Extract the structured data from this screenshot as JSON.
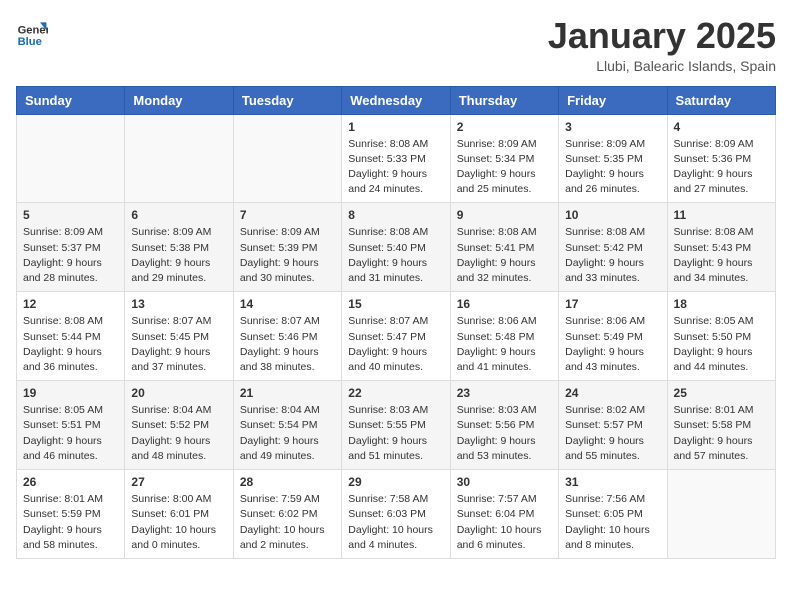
{
  "header": {
    "logo_general": "General",
    "logo_blue": "Blue",
    "month_title": "January 2025",
    "location": "Llubi, Balearic Islands, Spain"
  },
  "weekdays": [
    "Sunday",
    "Monday",
    "Tuesday",
    "Wednesday",
    "Thursday",
    "Friday",
    "Saturday"
  ],
  "weeks": [
    [
      {
        "day": "",
        "info": ""
      },
      {
        "day": "",
        "info": ""
      },
      {
        "day": "",
        "info": ""
      },
      {
        "day": "1",
        "info": "Sunrise: 8:08 AM\nSunset: 5:33 PM\nDaylight: 9 hours\nand 24 minutes."
      },
      {
        "day": "2",
        "info": "Sunrise: 8:09 AM\nSunset: 5:34 PM\nDaylight: 9 hours\nand 25 minutes."
      },
      {
        "day": "3",
        "info": "Sunrise: 8:09 AM\nSunset: 5:35 PM\nDaylight: 9 hours\nand 26 minutes."
      },
      {
        "day": "4",
        "info": "Sunrise: 8:09 AM\nSunset: 5:36 PM\nDaylight: 9 hours\nand 27 minutes."
      }
    ],
    [
      {
        "day": "5",
        "info": "Sunrise: 8:09 AM\nSunset: 5:37 PM\nDaylight: 9 hours\nand 28 minutes."
      },
      {
        "day": "6",
        "info": "Sunrise: 8:09 AM\nSunset: 5:38 PM\nDaylight: 9 hours\nand 29 minutes."
      },
      {
        "day": "7",
        "info": "Sunrise: 8:09 AM\nSunset: 5:39 PM\nDaylight: 9 hours\nand 30 minutes."
      },
      {
        "day": "8",
        "info": "Sunrise: 8:08 AM\nSunset: 5:40 PM\nDaylight: 9 hours\nand 31 minutes."
      },
      {
        "day": "9",
        "info": "Sunrise: 8:08 AM\nSunset: 5:41 PM\nDaylight: 9 hours\nand 32 minutes."
      },
      {
        "day": "10",
        "info": "Sunrise: 8:08 AM\nSunset: 5:42 PM\nDaylight: 9 hours\nand 33 minutes."
      },
      {
        "day": "11",
        "info": "Sunrise: 8:08 AM\nSunset: 5:43 PM\nDaylight: 9 hours\nand 34 minutes."
      }
    ],
    [
      {
        "day": "12",
        "info": "Sunrise: 8:08 AM\nSunset: 5:44 PM\nDaylight: 9 hours\nand 36 minutes."
      },
      {
        "day": "13",
        "info": "Sunrise: 8:07 AM\nSunset: 5:45 PM\nDaylight: 9 hours\nand 37 minutes."
      },
      {
        "day": "14",
        "info": "Sunrise: 8:07 AM\nSunset: 5:46 PM\nDaylight: 9 hours\nand 38 minutes."
      },
      {
        "day": "15",
        "info": "Sunrise: 8:07 AM\nSunset: 5:47 PM\nDaylight: 9 hours\nand 40 minutes."
      },
      {
        "day": "16",
        "info": "Sunrise: 8:06 AM\nSunset: 5:48 PM\nDaylight: 9 hours\nand 41 minutes."
      },
      {
        "day": "17",
        "info": "Sunrise: 8:06 AM\nSunset: 5:49 PM\nDaylight: 9 hours\nand 43 minutes."
      },
      {
        "day": "18",
        "info": "Sunrise: 8:05 AM\nSunset: 5:50 PM\nDaylight: 9 hours\nand 44 minutes."
      }
    ],
    [
      {
        "day": "19",
        "info": "Sunrise: 8:05 AM\nSunset: 5:51 PM\nDaylight: 9 hours\nand 46 minutes."
      },
      {
        "day": "20",
        "info": "Sunrise: 8:04 AM\nSunset: 5:52 PM\nDaylight: 9 hours\nand 48 minutes."
      },
      {
        "day": "21",
        "info": "Sunrise: 8:04 AM\nSunset: 5:54 PM\nDaylight: 9 hours\nand 49 minutes."
      },
      {
        "day": "22",
        "info": "Sunrise: 8:03 AM\nSunset: 5:55 PM\nDaylight: 9 hours\nand 51 minutes."
      },
      {
        "day": "23",
        "info": "Sunrise: 8:03 AM\nSunset: 5:56 PM\nDaylight: 9 hours\nand 53 minutes."
      },
      {
        "day": "24",
        "info": "Sunrise: 8:02 AM\nSunset: 5:57 PM\nDaylight: 9 hours\nand 55 minutes."
      },
      {
        "day": "25",
        "info": "Sunrise: 8:01 AM\nSunset: 5:58 PM\nDaylight: 9 hours\nand 57 minutes."
      }
    ],
    [
      {
        "day": "26",
        "info": "Sunrise: 8:01 AM\nSunset: 5:59 PM\nDaylight: 9 hours\nand 58 minutes."
      },
      {
        "day": "27",
        "info": "Sunrise: 8:00 AM\nSunset: 6:01 PM\nDaylight: 10 hours\nand 0 minutes."
      },
      {
        "day": "28",
        "info": "Sunrise: 7:59 AM\nSunset: 6:02 PM\nDaylight: 10 hours\nand 2 minutes."
      },
      {
        "day": "29",
        "info": "Sunrise: 7:58 AM\nSunset: 6:03 PM\nDaylight: 10 hours\nand 4 minutes."
      },
      {
        "day": "30",
        "info": "Sunrise: 7:57 AM\nSunset: 6:04 PM\nDaylight: 10 hours\nand 6 minutes."
      },
      {
        "day": "31",
        "info": "Sunrise: 7:56 AM\nSunset: 6:05 PM\nDaylight: 10 hours\nand 8 minutes."
      },
      {
        "day": "",
        "info": ""
      }
    ]
  ]
}
